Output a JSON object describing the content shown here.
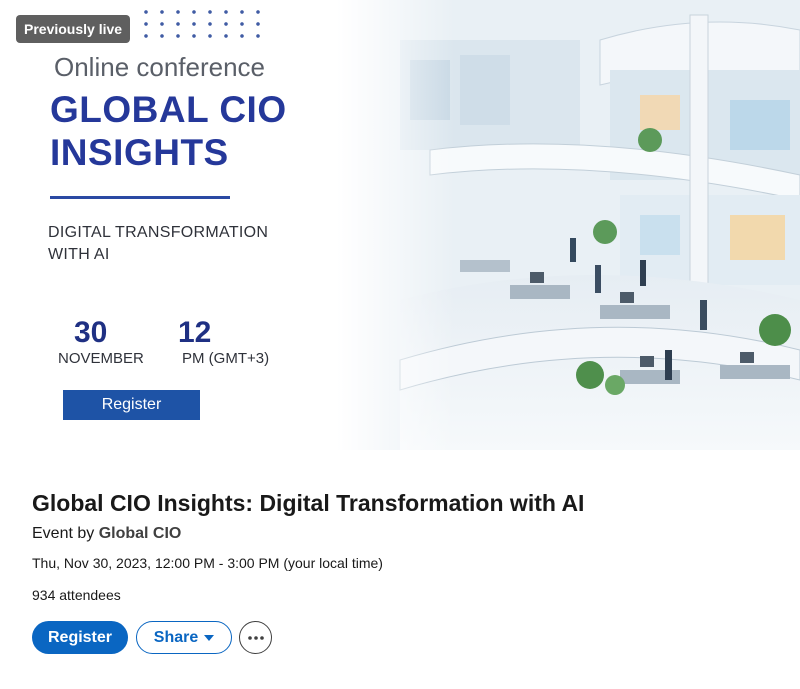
{
  "banner": {
    "badge": "Previously live",
    "subtitle": "Online conference",
    "title_line1": "GLOBAL CIO",
    "title_line2": "INSIGHTS",
    "theme_line1": "DIGITAL TRANSFORMATION",
    "theme_line2": "WITH AI",
    "day": "30",
    "month": "NOVEMBER",
    "hour": "12",
    "hour_label": "PM (GMT+3)",
    "register_label": "Register"
  },
  "event": {
    "title": "Global CIO Insights: Digital Transformation with AI",
    "organizer_prefix": "Event by ",
    "organizer_name": "Global CIO",
    "time": "Thu, Nov 30, 2023, 12:00 PM - 3:00 PM (your local time)",
    "attendees": "934 attendees"
  },
  "actions": {
    "register_label": "Register",
    "share_label": "Share",
    "more_icon": "ellipsis-icon",
    "share_icon": "caret-down-icon"
  },
  "colors": {
    "brand_blue": "#0a66c2",
    "banner_navy": "#25389a"
  }
}
